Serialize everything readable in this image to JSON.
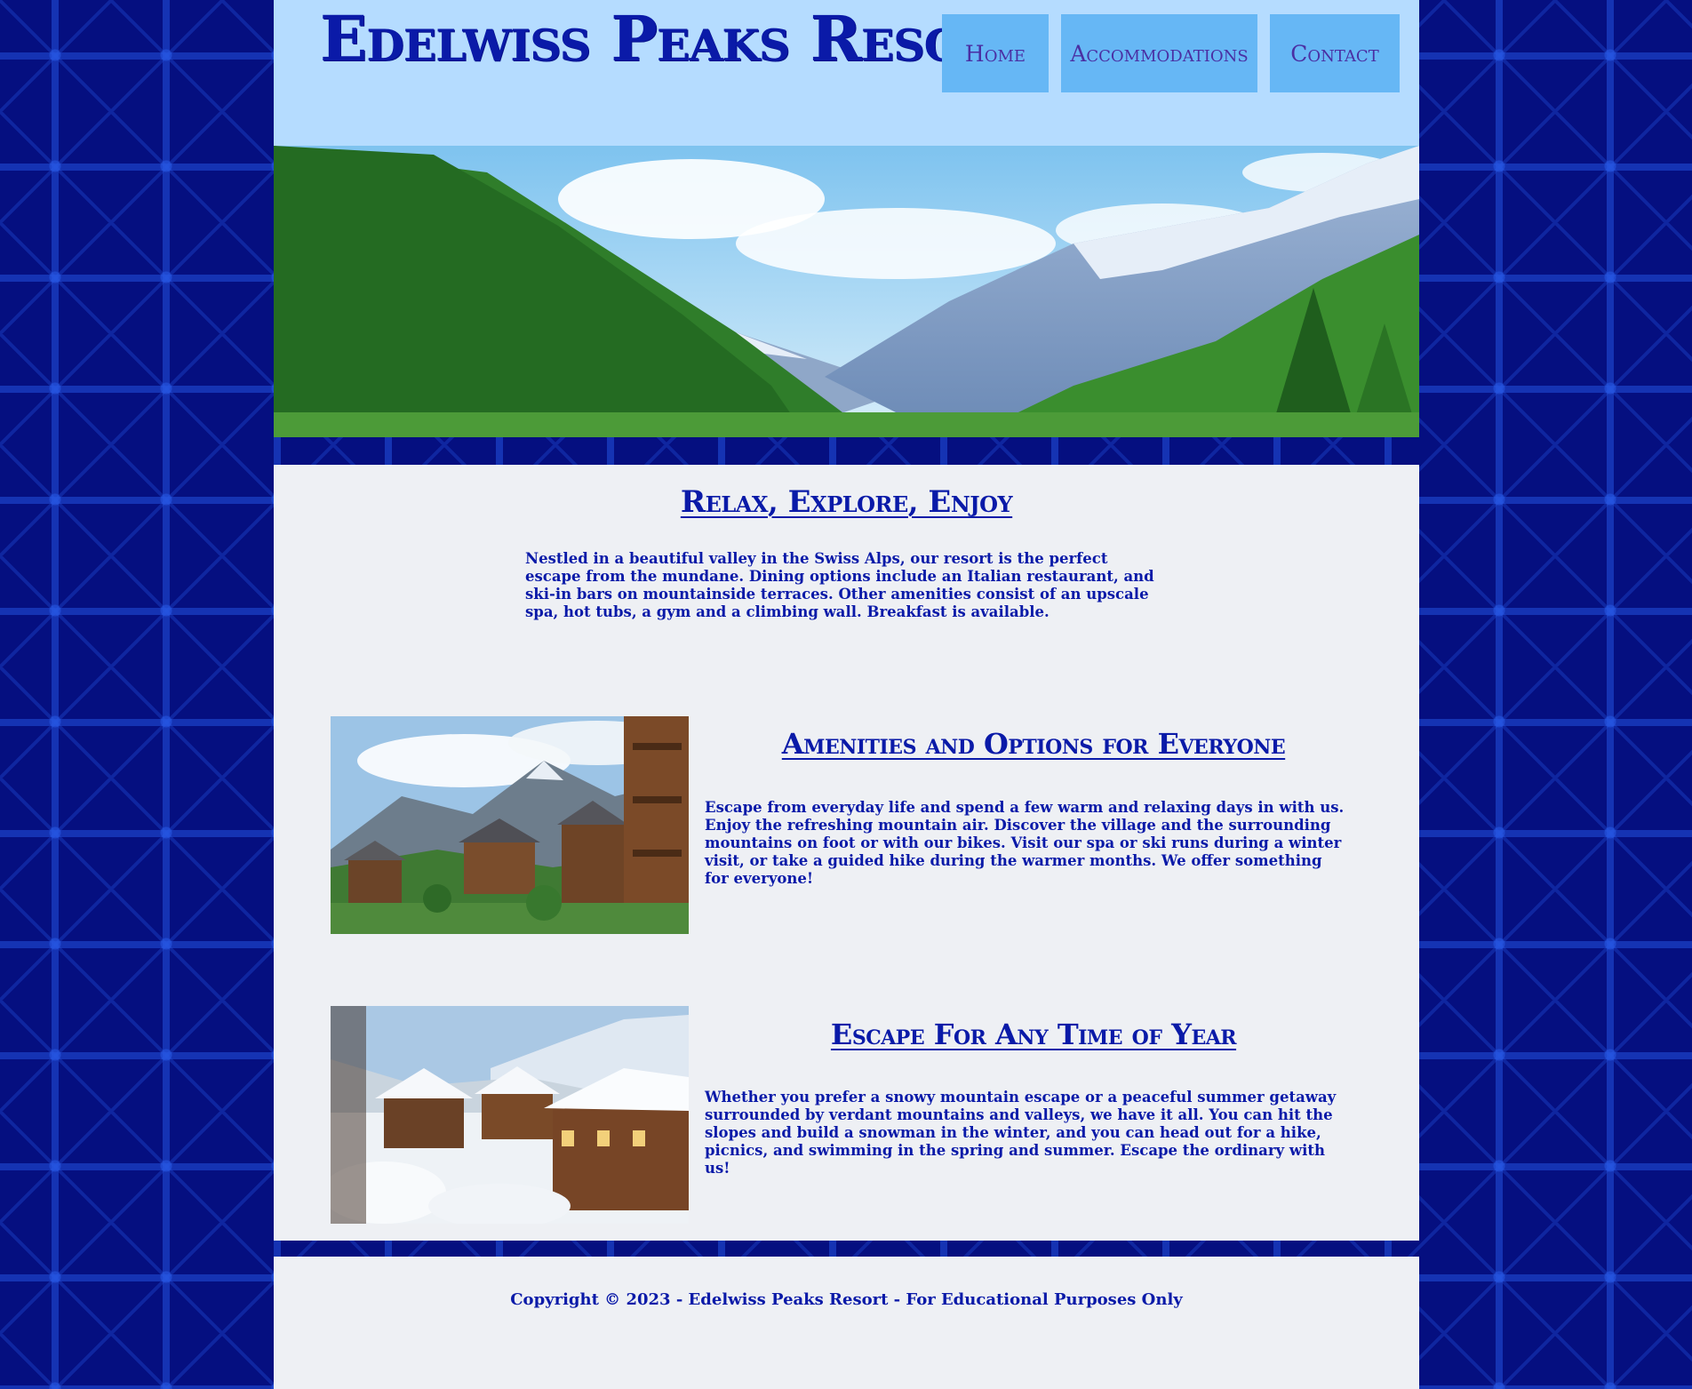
{
  "site": {
    "title": "Edelwiss Peaks Resort"
  },
  "nav": {
    "home": "Home",
    "accommodations": "Accommodations",
    "contact": "Contact"
  },
  "intro": {
    "heading": "Relax, Explore, Enjoy",
    "text": "Nestled in a beautiful valley in the Swiss Alps, our resort is the perfect escape from the mundane. Dining options include an Italian restaurant, and ski-in bars on mountainside terraces. Other amenities consist of an upscale spa, hot tubs, a gym and a climbing wall. Breakfast is available."
  },
  "amenities": {
    "heading": "Amenities and Options for Everyone",
    "text": "Escape from everyday life and spend a few warm and relaxing days in with us. Enjoy the refreshing mountain air. Discover the village and the surrounding mountains on foot or with our bikes. Visit our spa or ski runs during a winter visit, or take a guided hike during the warmer months. We offer something for everyone!"
  },
  "escape": {
    "heading": "Escape For Any Time of Year",
    "text": "Whether you prefer a snowy mountain escape or a peaceful summer getaway surrounded by verdant mountains and valleys, we have it all. You can hit the slopes and build a snowman in the winter, and you can head out for a hike, picnics, and swimming in the spring and summer. Escape the ordinary with us!"
  },
  "footer": {
    "copyright": "Copyright © 2023 - Edelwiss Peaks Resort - For Educational Purposes Only"
  },
  "colors": {
    "page_background": "#050f80",
    "header_background": "#b5dcff",
    "nav_button": "#66b7f5",
    "nav_text": "#4a2fa3",
    "text": "#0a1aa8",
    "content_background": "#eef0f4"
  }
}
